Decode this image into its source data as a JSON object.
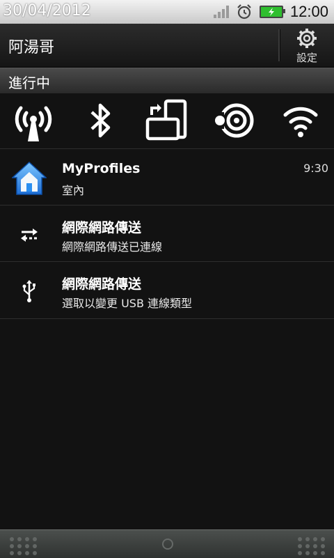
{
  "status_bar": {
    "date": "30/04/2012",
    "time": "12:00",
    "icons": [
      "signal-icon",
      "alarm-icon",
      "battery-charging-icon"
    ]
  },
  "header": {
    "owner_name": "阿湯哥",
    "settings_label": "設定"
  },
  "ongoing": {
    "section_title": "進行中"
  },
  "quick_toggles": [
    {
      "name": "mobile-network-toggle",
      "icon": "antenna-icon"
    },
    {
      "name": "bluetooth-toggle",
      "icon": "bluetooth-icon"
    },
    {
      "name": "auto-rotate-toggle",
      "icon": "rotate-icon"
    },
    {
      "name": "hotspot-toggle",
      "icon": "hotspot-icon"
    },
    {
      "name": "wifi-toggle",
      "icon": "wifi-icon"
    }
  ],
  "notifications": [
    {
      "title": "MyProfiles",
      "subtitle": "室內",
      "time": "9:30",
      "icon": "home-icon"
    },
    {
      "title": "網際網路傳送",
      "subtitle": "網際網路傳送已連線",
      "icon": "data-transfer-icon"
    },
    {
      "title": "網際網路傳送",
      "subtitle": "選取以變更 USB 連線類型",
      "icon": "usb-icon"
    }
  ],
  "colors": {
    "background": "#121212",
    "home_icon_blue": "#2a8ff0",
    "battery_green": "#2fbf2f"
  }
}
